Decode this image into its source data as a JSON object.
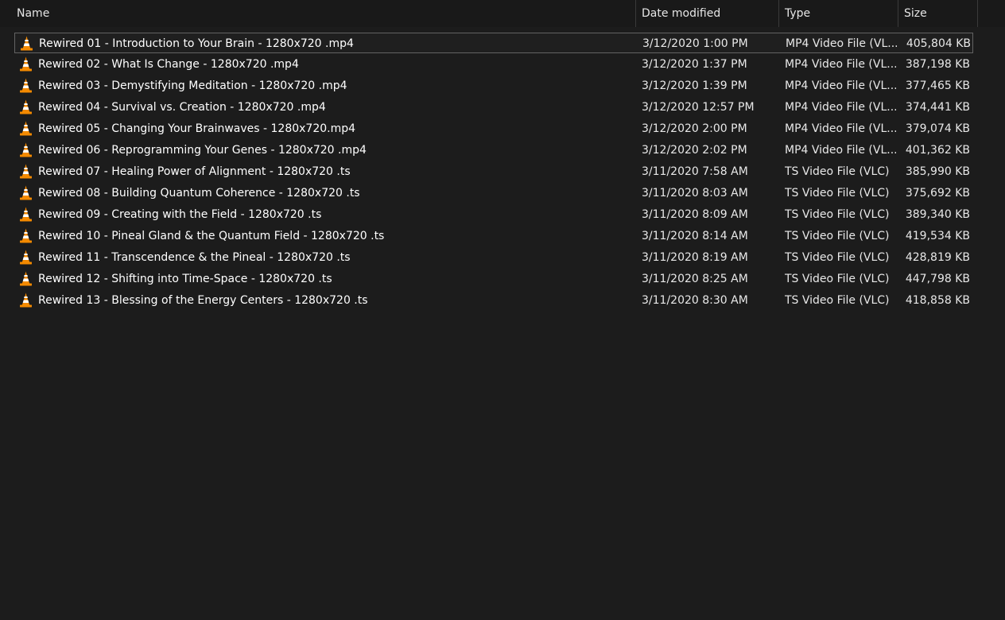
{
  "header": {
    "name": "Name",
    "date_modified": "Date modified",
    "type": "Type",
    "size": "Size",
    "sort_indicator": "^"
  },
  "icon": {
    "name": "vlc-cone-icon",
    "color_orange": "#f48a00",
    "color_white": "#ffffff"
  },
  "colors": {
    "background": "#1c1c1c",
    "selection_border": "#636363",
    "text": "#ffffff"
  },
  "files": [
    {
      "name": "Rewired 01 - Introduction to Your Brain - 1280x720 .mp4",
      "date": "3/12/2020 1:00 PM",
      "type": "MP4 Video File (VL...",
      "size": "405,804 KB",
      "selected": true
    },
    {
      "name": "Rewired 02 - What Is Change - 1280x720 .mp4",
      "date": "3/12/2020 1:37 PM",
      "type": "MP4 Video File (VL...",
      "size": "387,198 KB"
    },
    {
      "name": "Rewired 03 - Demystifying Meditation - 1280x720 .mp4",
      "date": "3/12/2020 1:39 PM",
      "type": "MP4 Video File (VL...",
      "size": "377,465 KB"
    },
    {
      "name": "Rewired 04 - Survival vs. Creation - 1280x720 .mp4",
      "date": "3/12/2020 12:57 PM",
      "type": "MP4 Video File (VL...",
      "size": "374,441 KB"
    },
    {
      "name": "Rewired 05 - Changing Your Brainwaves - 1280x720.mp4",
      "date": "3/12/2020 2:00 PM",
      "type": "MP4 Video File (VL...",
      "size": "379,074 KB"
    },
    {
      "name": "Rewired 06 - Reprogramming Your Genes - 1280x720 .mp4",
      "date": "3/12/2020 2:02 PM",
      "type": "MP4 Video File (VL...",
      "size": "401,362 KB"
    },
    {
      "name": "Rewired 07 - Healing Power of Alignment - 1280x720 .ts",
      "date": "3/11/2020 7:58 AM",
      "type": "TS Video File (VLC)",
      "size": "385,990 KB"
    },
    {
      "name": "Rewired 08 - Building Quantum Coherence - 1280x720 .ts",
      "date": "3/11/2020 8:03 AM",
      "type": "TS Video File (VLC)",
      "size": "375,692 KB"
    },
    {
      "name": "Rewired 09 - Creating with the Field - 1280x720 .ts",
      "date": "3/11/2020 8:09 AM",
      "type": "TS Video File (VLC)",
      "size": "389,340 KB"
    },
    {
      "name": "Rewired 10 - Pineal Gland & the Quantum Field - 1280x720 .ts",
      "date": "3/11/2020 8:14 AM",
      "type": "TS Video File (VLC)",
      "size": "419,534 KB"
    },
    {
      "name": "Rewired 11 - Transcendence & the Pineal - 1280x720 .ts",
      "date": "3/11/2020 8:19 AM",
      "type": "TS Video File (VLC)",
      "size": "428,819 KB"
    },
    {
      "name": "Rewired 12 - Shifting into Time-Space - 1280x720 .ts",
      "date": "3/11/2020 8:25 AM",
      "type": "TS Video File (VLC)",
      "size": "447,798 KB"
    },
    {
      "name": "Rewired 13 - Blessing of the Energy Centers - 1280x720 .ts",
      "date": "3/11/2020 8:30 AM",
      "type": "TS Video File (VLC)",
      "size": "418,858 KB"
    }
  ]
}
